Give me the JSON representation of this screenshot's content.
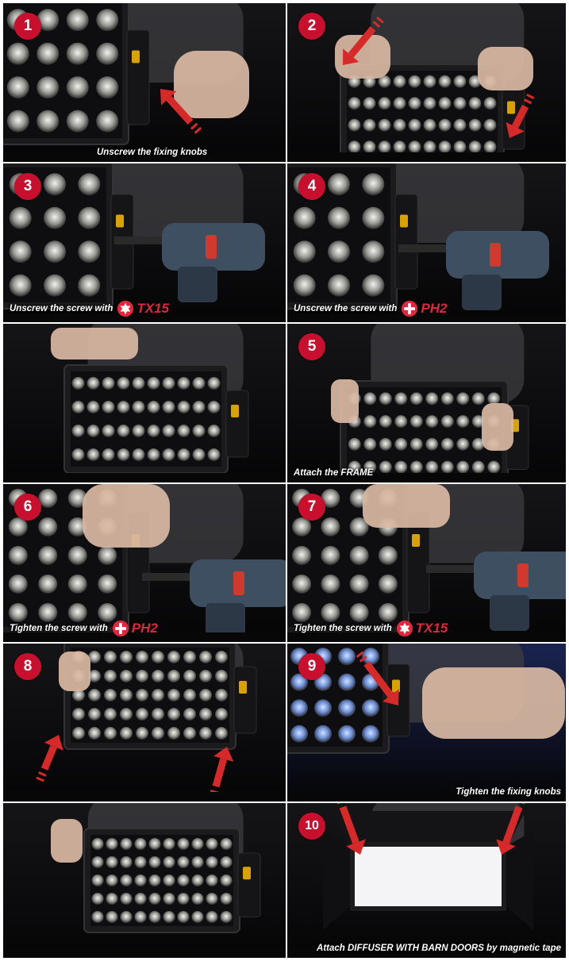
{
  "colors": {
    "badge": "#c8102e",
    "tool_text": "#e3263b",
    "arrow": "#d62a2a",
    "caption": "#ffffff"
  },
  "panels": [
    {
      "badge": "1",
      "caption": "Unscrew the fixing knobs"
    },
    {
      "badge": "2",
      "caption": ""
    },
    {
      "badge": "3",
      "caption": "Unscrew the screw with",
      "tool": "TX15",
      "tool_icon": "torx-star-icon"
    },
    {
      "badge": "4",
      "caption": "Unscrew the screw with",
      "tool": "PH2",
      "tool_icon": "phillips-cross-icon"
    },
    {
      "badge": "",
      "caption": ""
    },
    {
      "badge": "5",
      "caption": "Attach the FRAME"
    },
    {
      "badge": "6",
      "caption": "Tighten the screw with",
      "tool": "PH2",
      "tool_icon": "phillips-cross-icon"
    },
    {
      "badge": "7",
      "caption": "Tighten the screw with",
      "tool": "TX15",
      "tool_icon": "torx-star-icon"
    },
    {
      "badge": "8",
      "caption": ""
    },
    {
      "badge": "9",
      "caption": "Tighten the fixing knobs"
    },
    {
      "badge": "",
      "caption": ""
    },
    {
      "badge": "10",
      "caption": "Attach DIFFUSER WITH BARN DOORS by magnetic tape"
    }
  ]
}
